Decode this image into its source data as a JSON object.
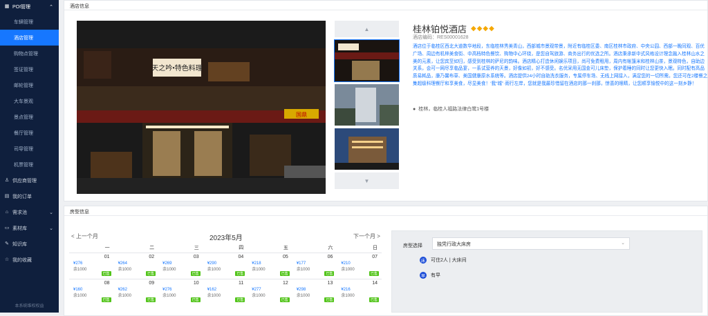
{
  "sidebar": {
    "group": "POI管理",
    "sub_items": [
      "车辆管理",
      "酒店管理",
      "购物点管理",
      "签证管理",
      "邮轮管理",
      "大车景观",
      "景点管理",
      "餐厅管理",
      "司导管理",
      "机票管理"
    ],
    "active_index": 1,
    "main_items": [
      {
        "label": "供应商管理",
        "icon": "user-icon",
        "expand": false
      },
      {
        "label": "我的订单",
        "icon": "order-icon",
        "expand": false
      },
      {
        "label": "需求池",
        "icon": "cart-icon",
        "expand": true
      },
      {
        "label": "素材库",
        "icon": "folder-icon",
        "expand": true
      },
      {
        "label": "知识库",
        "icon": "book-icon",
        "expand": false
      },
      {
        "label": "我的收藏",
        "icon": "star-icon",
        "expand": false
      }
    ],
    "footer": "本系统维权权益"
  },
  "hotel": {
    "card_title": "酒店信息",
    "name": "桂林铂悦酒店",
    "diamonds": "◆◆◆◆",
    "code": "酒店编码：RES00001628",
    "description": "酒店位于临桂区西北大道数华地段，东临桂林秀美青山，西部城市景观带景，附近有临桂区委、南区桂林市政府、中央公园、西部一晚同观、百优广场、周边有机林美食街、中高档特色餐饮、购物中心环绕，是您自驾旅游、商务出行的优选之所。酒店秉承新中式风格设计理念融入桂林山水之美的元素，让您宾至如归，感受到桂林的萨尼的韵味。酒店精心打造休闲娱乐项目，尚可免费租用，周内有帐篷米和桂林山茶，景观特色，自助边关系，会可一网尽享临品宴，一系试营养的天景，好像如初，好不感受。名优采用无国金可儿床垫，保护着睡的同时让您更快入眠。同时配有高品质易耗品，康乃馨布草、美国健康原水系统等。酒店提供24小时自助洗衣服务，专属停车场、无线上网接入，满足您的一切所需。您还可在2楼餐之集超级科理餐厅和享美食，尽显美食！‘我“城”·雨行左岸，您就是我最珍惜留在酒店的那一刹那，惊喜的眼睛，让您顺享愉悦中的这一刻乡静！",
    "address": "桂林，临桂人福路法律白鹭1号楼",
    "photo_signs": [
      "天之吟•特色料理",
      "国鼎"
    ]
  },
  "room": {
    "card_title": "房型信息",
    "select_label": "房型选择",
    "selected": "独凭行政大床房",
    "features": [
      "可住2人 | 大床间",
      "有早"
    ]
  },
  "calendar": {
    "prev": "< 上一个月",
    "next": "下一个月 >",
    "title": "2023年5月",
    "weekdays": [
      "一",
      "二",
      "三",
      "四",
      "五",
      "六",
      "日"
    ],
    "weeks": [
      [
        {
          "d": "01",
          "p": "¥276",
          "s": "余1000"
        },
        {
          "d": "02",
          "p": "¥264",
          "s": "余1000"
        },
        {
          "d": "03",
          "p": "¥269",
          "s": "余1000"
        },
        {
          "d": "04",
          "p": "¥290",
          "s": "余1000"
        },
        {
          "d": "05",
          "p": "¥218",
          "s": "余1000"
        },
        {
          "d": "06",
          "p": "¥177",
          "s": "余1000"
        },
        {
          "d": "07",
          "p": "¥210",
          "s": "余1000"
        }
      ],
      [
        {
          "d": "08",
          "p": "¥160",
          "s": "余1000"
        },
        {
          "d": "09",
          "p": "¥262",
          "s": "余1000"
        },
        {
          "d": "10",
          "p": "¥276",
          "s": "余1000"
        },
        {
          "d": "11",
          "p": "¥162",
          "s": "余1000"
        },
        {
          "d": "12",
          "p": "¥277",
          "s": "余1000"
        },
        {
          "d": "13",
          "p": "¥298",
          "s": "余1000"
        },
        {
          "d": "14",
          "p": "¥216",
          "s": "余1000"
        }
      ]
    ],
    "tag": "已售"
  }
}
